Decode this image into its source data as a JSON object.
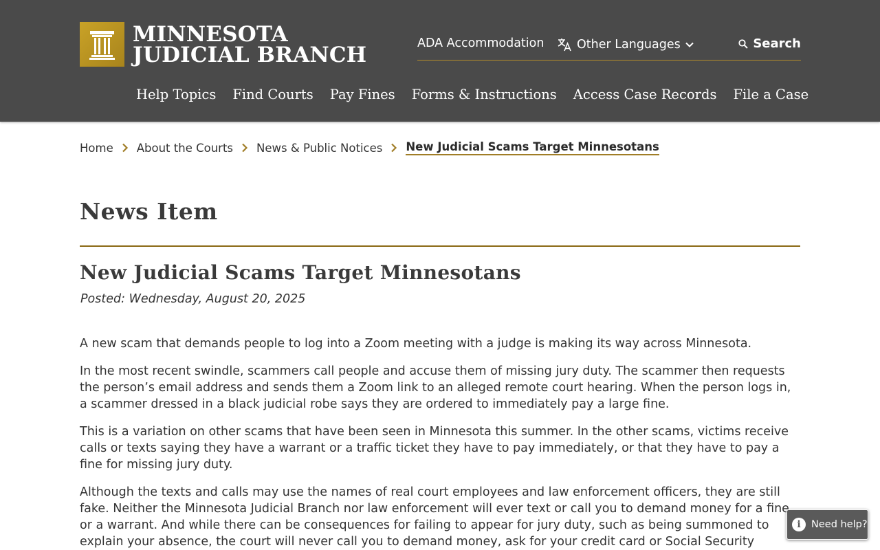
{
  "header": {
    "logo_line1": "MINNESOTA",
    "logo_line2": "JUDICIAL BRANCH",
    "utility": {
      "ada": "ADA Accommodation",
      "languages": "Other Languages",
      "search": "Search"
    },
    "nav": [
      "Help Topics",
      "Find Courts",
      "Pay Fines",
      "Forms & Instructions",
      "Access Case Records",
      "File a Case"
    ]
  },
  "breadcrumb": {
    "items": [
      "Home",
      "About the Courts",
      "News & Public Notices"
    ],
    "current": "New Judicial Scams Target Minnesotans"
  },
  "page": {
    "title": "News Item",
    "article_title": "New Judicial Scams Target Minnesotans",
    "posted": "Posted: Wednesday, August 20, 2025",
    "paragraphs": [
      "A new scam that demands people to log into a Zoom meeting with a judge is making its way across Minnesota.",
      "In the most recent swindle, scammers call people and accuse them of missing jury duty. The scammer then requests the person’s email address and sends them a Zoom link to an alleged remote court hearing. When the person logs in, a scammer dressed in a black judicial robe says they are ordered to immediately pay a large fine.",
      "This is a variation on other scams that have been seen in Minnesota this summer. In the other scams, victims receive calls or texts saying they have a warrant or a traffic ticket they have to pay immediately, or that they have to pay a fine for missing jury duty.",
      "Although the texts and calls may use the names of real court employees and law enforcement officers, they are still fake. Neither the Minnesota Judicial Branch nor law enforcement will ever text or call you to demand money for a fine or a warrant. And while there can be consequences for failing to appear for jury duty, such as being summoned to explain your absence, the court will never call you to demand money, ask for your credit card or Social Security number, or require that"
    ]
  },
  "help_widget": {
    "label": "Need help?",
    "icon_glyph": "i"
  },
  "colors": {
    "header_bg": "#4a4a4a",
    "accent_gold": "#b58d2a",
    "rule_gold": "#8b6914"
  },
  "icons": [
    "pillar-seal-icon",
    "translate-icon",
    "chevron-down-icon",
    "search-icon",
    "chevron-right-icon",
    "info-icon"
  ]
}
